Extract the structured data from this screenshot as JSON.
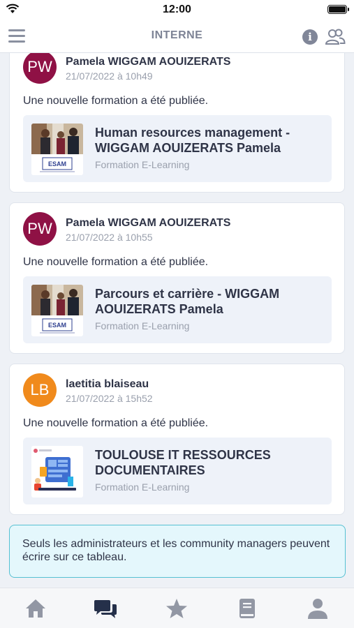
{
  "status_bar": {
    "time": "12:00"
  },
  "header": {
    "title": "INTERNE"
  },
  "posts": [
    {
      "author": "Pamela WIGGAM AOUIZERATS",
      "initials": "PW",
      "date": "21/07/2022 à 10h49",
      "message": "Une nouvelle formation a été publiée.",
      "card_title": "Human resources management - WIGGAM AOUIZERATS Pamela",
      "card_subtitle": "Formation E-Learning",
      "thumb_text": "ESAM"
    },
    {
      "author": "Pamela WIGGAM AOUIZERATS",
      "initials": "PW",
      "date": "21/07/2022 à 10h55",
      "message": "Une nouvelle formation a été publiée.",
      "card_title": "Parcours et carrière - WIGGAM AOUIZERATS Pamela",
      "card_subtitle": "Formation E-Learning",
      "thumb_text": "ESAM"
    },
    {
      "author": "laetitia blaiseau",
      "initials": "LB",
      "date": "21/07/2022 à 15h52",
      "message": "Une nouvelle formation a été publiée.",
      "card_title": "TOULOUSE IT RESSOURCES DOCUMENTAIRES",
      "card_subtitle": "Formation E-Learning"
    }
  ],
  "notice": {
    "text": "Seuls les administrateurs et les community managers peuvent écrire sur ce tableau."
  },
  "tabs": [
    {
      "icon": "home-icon",
      "active": false
    },
    {
      "icon": "chat-icon",
      "active": true
    },
    {
      "icon": "star-icon",
      "active": false
    },
    {
      "icon": "book-icon",
      "active": false
    },
    {
      "icon": "profile-icon",
      "active": false
    }
  ],
  "colors": {
    "pw_avatar": "#8f1145",
    "lb_avatar": "#f08a1c",
    "tab_active": "#25304a",
    "tab_inactive": "#9297a4",
    "notice_border": "#56c0d2"
  }
}
